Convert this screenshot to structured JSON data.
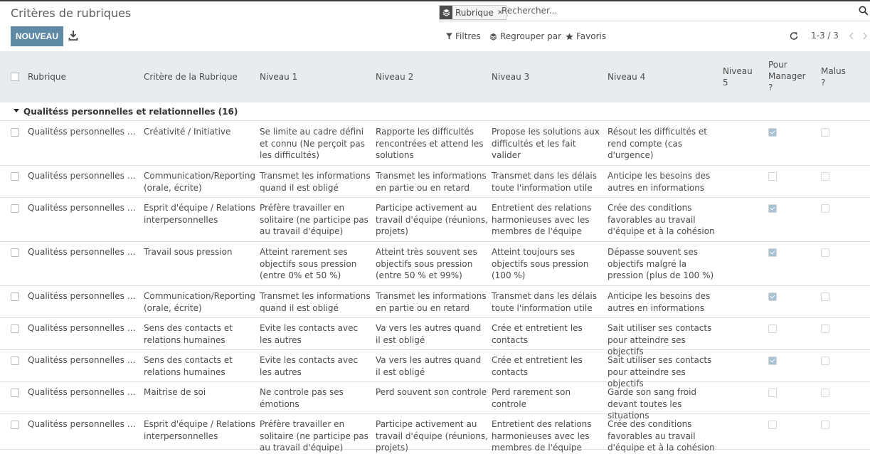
{
  "page": {
    "title": "Critères de rubriques"
  },
  "search": {
    "facet_label": "Rubrique",
    "facet_remove": "×",
    "placeholder": "Rechercher..."
  },
  "toolbar": {
    "new_label": "NOUVEAU",
    "filters_label": "Filtres",
    "groupby_label": "Regrouper par",
    "favorites_label": "Favoris"
  },
  "pager": {
    "value": "1-3 / 3"
  },
  "columns": {
    "rubrique": "Rubrique",
    "critere": "Critère de la Rubrique",
    "niveau1": "Niveau 1",
    "niveau2": "Niveau 2",
    "niveau3": "Niveau 3",
    "niveau4": "Niveau 4",
    "niveau5": "Niveau 5",
    "pour_manager": "Pour Manager ?",
    "malus": "Malus ?"
  },
  "group": {
    "label": "Qualitéss personnelles et relationnelles (16)"
  },
  "rows": [
    {
      "rubrique": "Qualitéss personnelles et relationnelles",
      "critere": "Créativité / Initiative",
      "niveau1": "Se limite au cadre défini et connu (Ne perçoit pas les difficultés)",
      "niveau2": "Rapporte les difficultés rencontrées et attend les solutions",
      "niveau3": "Propose les solutions  aux difficultés et les fait valider",
      "niveau4": "Résout les difficultés et rend compte (cas d'urgence)",
      "manager": true,
      "malus": false
    },
    {
      "rubrique": "Qualitéss personnelles et relationnelles",
      "critere": "Communication/Reporting (orale, écrite)",
      "niveau1": "Transmet les informations quand il est obligé",
      "niveau2": "Transmet les informations en partie ou en retard",
      "niveau3": "Transmet dans les délais toute l'information utile",
      "niveau4": "Anticipe les besoins des autres en informations",
      "manager": false,
      "malus": false
    },
    {
      "rubrique": "Qualitéss personnelles et relationnelles",
      "critere": "Esprit d'équipe / Relations interpersonnelles",
      "niveau1": "Préfère travailler en solitaire (ne participe pas au travail d'équipe)",
      "niveau2": "Participe activement au travail d'équipe (réunions, projets)",
      "niveau3": "Entretient des relations harmonieuses avec les membres de l'équipe",
      "niveau4": "Crée des conditions favorables au travail d'équipe et à  la cohésion",
      "manager": true,
      "malus": false
    },
    {
      "rubrique": "Qualitéss personnelles et relationnelles",
      "critere": "Travail sous pression",
      "niveau1": "Atteint rarement ses objectifs sous  pression (entre 0% et 50 %)",
      "niveau2": "Atteint très souvent ses objectifs sous  pression (entre 50 % et 99%)",
      "niveau3": "Atteint toujours ses objectifs sous pression (100 %)",
      "niveau4": "Dépasse souvent ses objectifs malgré la pression (plus de 100  %)",
      "manager": true,
      "malus": false
    },
    {
      "rubrique": "Qualitéss personnelles et relationnelles",
      "critere": "Communication/Reporting (orale, écrite)",
      "niveau1": "Transmet les informations quand il est obligé",
      "niveau2": "Transmet les informations en partie ou en retard",
      "niveau3": "Transmet dans les délais toute l'information utile",
      "niveau4": "Anticipe les besoins des autres en informations",
      "manager": true,
      "malus": false
    },
    {
      "rubrique": "Qualitéss personnelles et relationnelles",
      "critere": "Sens des contacts et relations humaines",
      "niveau1": "Evite les contacts avec les autres",
      "niveau2": "Va vers les autres quand il est obligé",
      "niveau3": "Crée et entretient les contacts",
      "niveau4": "Sait utiliser ses contacts pour atteindre ses objectifs",
      "manager": false,
      "malus": false
    },
    {
      "rubrique": "Qualitéss personnelles et relationnelles",
      "critere": "Sens des contacts et relations humaines",
      "niveau1": "Evite les contacts avec les autres",
      "niveau2": "Va vers les autres quand il est obligé",
      "niveau3": "Crée et entretient les contacts",
      "niveau4": "Sait utiliser ses contacts pour atteindre ses objectifs",
      "manager": true,
      "malus": false
    },
    {
      "rubrique": "Qualitéss personnelles et relationnelles",
      "critere": "Maitrise de soi",
      "niveau1": "Ne controle pas ses émotions",
      "niveau2": "Perd souvent son controle",
      "niveau3": "Perd rarement son controle",
      "niveau4": "Garde son sang froid devant toutes les situations",
      "manager": false,
      "malus": false
    },
    {
      "rubrique": "Qualitéss personnelles et relationnelles",
      "critere": "Esprit d'équipe / Relations interpersonnelles",
      "niveau1": "Préfère travailler en solitaire (ne participe pas au travail d'équipe)",
      "niveau2": "Participe activement au travail d'équipe (réunions, projets)",
      "niveau3": "Entretient des relations harmonieuses avec les membres de l'équipe",
      "niveau4": "Crée des conditions favorables au travail d'équipe et à  la cohésion",
      "manager": false,
      "malus": false
    }
  ]
}
